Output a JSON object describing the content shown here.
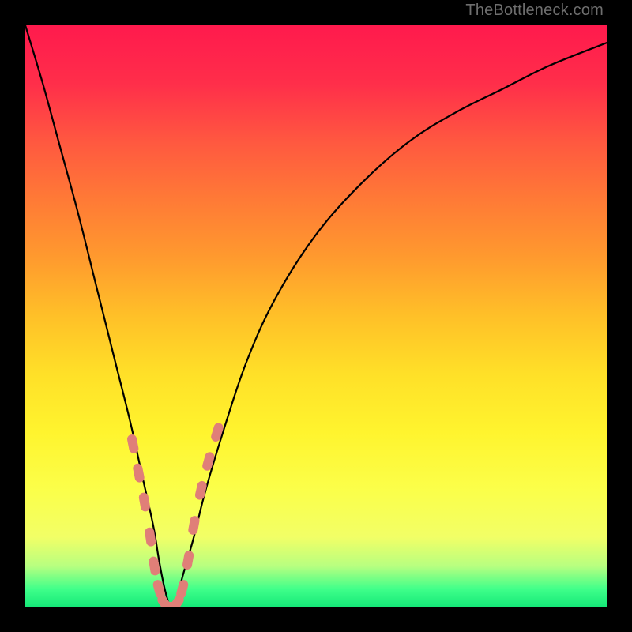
{
  "watermark": "TheBottleneck.com",
  "chart_data": {
    "type": "line",
    "title": "",
    "xlabel": "",
    "ylabel": "",
    "xlim": [
      0,
      100
    ],
    "ylim": [
      0,
      100
    ],
    "grid": false,
    "legend": false,
    "background_gradient": {
      "top": "#ff1a4d",
      "middle": "#ffe028",
      "bottom": "#15e878"
    },
    "series": [
      {
        "name": "bottleneck-curve",
        "x": [
          0,
          3,
          6,
          9,
          12,
          15,
          18,
          20,
          22,
          23,
          24,
          25,
          26,
          27,
          29,
          31,
          34,
          38,
          43,
          50,
          58,
          66,
          74,
          82,
          90,
          100
        ],
        "values": [
          100,
          90,
          79,
          68,
          56,
          44,
          32,
          23,
          14,
          8,
          3,
          0,
          1,
          5,
          12,
          20,
          30,
          42,
          53,
          64,
          73,
          80,
          85,
          89,
          93,
          97
        ]
      }
    ],
    "markers": {
      "name": "highlighted-points",
      "shape": "rounded-bar",
      "color": "#e07f78",
      "points": [
        {
          "x": 18.5,
          "y": 28
        },
        {
          "x": 19.5,
          "y": 23
        },
        {
          "x": 20.5,
          "y": 18
        },
        {
          "x": 21.5,
          "y": 12
        },
        {
          "x": 22.2,
          "y": 7
        },
        {
          "x": 23.0,
          "y": 3
        },
        {
          "x": 24.0,
          "y": 0.5
        },
        {
          "x": 25.0,
          "y": 0
        },
        {
          "x": 26.0,
          "y": 0.5
        },
        {
          "x": 27.0,
          "y": 3
        },
        {
          "x": 28.0,
          "y": 8
        },
        {
          "x": 29.0,
          "y": 14
        },
        {
          "x": 30.2,
          "y": 20
        },
        {
          "x": 31.5,
          "y": 25
        },
        {
          "x": 33.0,
          "y": 30
        }
      ]
    }
  }
}
